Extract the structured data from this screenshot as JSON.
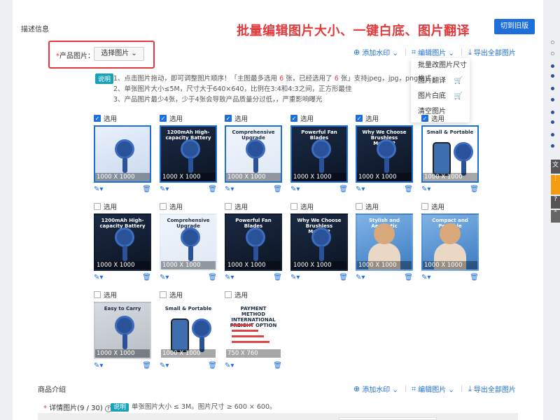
{
  "section_title": "描述信息",
  "headline": "批量编辑图片大小、一键白底、图片翻译",
  "switch_button": "切到旧版",
  "product_images": {
    "label_req": "*",
    "label": "产品图片：",
    "pick_button": "选择图片 ⌄"
  },
  "toolbar": {
    "add_watermark": "添加水印 ⌄",
    "edit_image": "编辑图片 ⌄",
    "export_all": "导出全部图片"
  },
  "edit_menu": [
    "批量改图片尺寸",
    "图片翻译",
    "图片白底",
    "清空图片"
  ],
  "note": {
    "badge": "说明",
    "line1_a": "1、点击图片拖动，即可调整图片顺序！「主图最多选用",
    "line1_n1": "6",
    "line1_b": "张，已经选用了",
    "line1_n2": "6",
    "line1_c": "张」支持jpeg，jpg，png格式",
    "line2": "2、单张图片大小≤5M，尺寸大于640×640，比例在3:4和4:3之间，正方形最佳",
    "line3": "3、产品图片最少4张，少于4张会导致产品质量分过低，，严重影响曝光"
  },
  "select_label": "选用",
  "images": [
    {
      "checked": true,
      "size": "1000 X 1000",
      "caption": "",
      "style": "t-blue",
      "kind": "fan"
    },
    {
      "checked": true,
      "size": "1000 X 1000",
      "caption": "1200mAh High-capacity Battery",
      "style": "t-dark",
      "kind": "fan"
    },
    {
      "checked": true,
      "size": "1000 X 1000",
      "caption": "Comprehensive Upgrade",
      "style": "t-pale",
      "kind": "fan"
    },
    {
      "checked": true,
      "size": "1000 X 1000",
      "caption": "Powerful Fan Blades",
      "style": "t-dark",
      "kind": "fan"
    },
    {
      "checked": true,
      "size": "1000 X 1000",
      "caption": "Why We Choose Brushless Motors?",
      "style": "t-dark",
      "kind": "fan"
    },
    {
      "checked": true,
      "size": "1000 X 1000",
      "caption": "Small & Portable",
      "style": "t-white",
      "kind": "phone"
    },
    {
      "checked": false,
      "size": "1000 X 1000",
      "caption": "1200mAh High-capacity Battery",
      "style": "t-dark",
      "kind": "fan"
    },
    {
      "checked": false,
      "size": "1000 X 1000",
      "caption": "Comprehensive Upgrade",
      "style": "t-pale",
      "kind": "fan"
    },
    {
      "checked": false,
      "size": "1000 X 1000",
      "caption": "Powerful Fan Blades",
      "style": "t-dark",
      "kind": "fan"
    },
    {
      "checked": false,
      "size": "1000 X 1000",
      "caption": "Why We Choose Brushless Motors?",
      "style": "t-dark",
      "kind": "fan"
    },
    {
      "checked": false,
      "size": "1000 X 1000",
      "caption": "Stylish and Aesthetic",
      "style": "t-sky",
      "kind": "person"
    },
    {
      "checked": false,
      "size": "1000 X 1000",
      "caption": "Compact and Portable",
      "style": "t-sky",
      "kind": "person"
    },
    {
      "checked": false,
      "size": "1000 X 1000",
      "caption": "Easy to Carry",
      "style": "t-gray",
      "kind": "fan"
    },
    {
      "checked": false,
      "size": "1000 X 1000",
      "caption": "Small & Portable",
      "style": "t-white",
      "kind": "phone"
    },
    {
      "checked": false,
      "size": "750 X 760",
      "caption": "PAYMENT METHOD  INTERNATIONAL FREIGHT OPTION",
      "style": "t-white",
      "kind": "invoice"
    }
  ],
  "product_intro": {
    "title": "商品介绍",
    "detail_req": "*",
    "detail_label": "详情图片(9 / 30)",
    "detail_badge": "说明",
    "detail_note": "单张图片大小 ≤ 3M。图片尺寸 ≥ 600 × 600。"
  },
  "colors": {
    "accent": "#1e6fd9",
    "highlight": "#e4393c",
    "badge": "#17a2b8"
  },
  "icons": {
    "wand": "magic-wand-icon",
    "trash": "trash-icon",
    "download": "download-icon",
    "crop": "crop-icon",
    "watermark": "watermark-icon"
  }
}
